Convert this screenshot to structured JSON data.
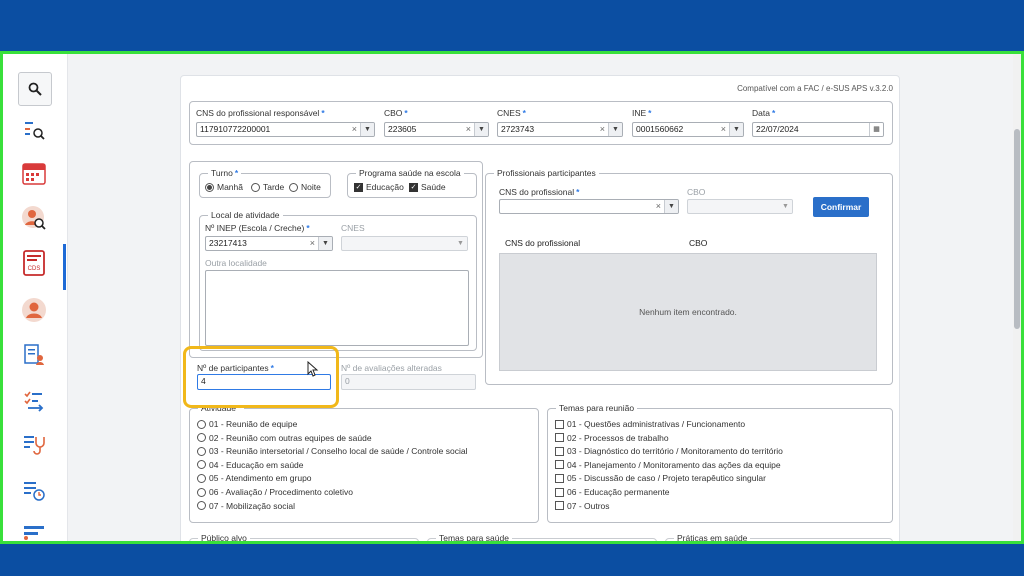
{
  "form": {
    "compat_text": "Compatível com a FAC / e-SUS APS v.3.2.0",
    "cns_responsavel": {
      "label": "CNS do profissional responsável",
      "value": "117910772200001"
    },
    "cbo": {
      "label": "CBO",
      "value": "223605"
    },
    "cnes": {
      "label": "CNES",
      "value": "2723743"
    },
    "ine": {
      "label": "INE",
      "value": "0001560662"
    },
    "data": {
      "label": "Data",
      "value": "22/07/2024"
    },
    "turno": {
      "legend": "Turno",
      "options": [
        "Manhã",
        "Tarde",
        "Noite"
      ],
      "selected": "Manhã"
    },
    "programa": {
      "legend": "Programa saúde na escola",
      "options": [
        "Educação",
        "Saúde"
      ]
    },
    "local": {
      "legend": "Local de atividade",
      "inep_label": "Nº INEP (Escola / Creche)",
      "inep_value": "23217413",
      "cnes_label": "CNES",
      "outra_label": "Outra localidade"
    },
    "participantes_label": "Nº de participantes",
    "participantes_value": "4",
    "avaliacoes_label": "Nº de avaliações alteradas",
    "avaliacoes_value": "0",
    "profissionais": {
      "legend": "Profissionais participantes",
      "cns_label": "CNS do profissional",
      "cbo_label": "CBO",
      "confirm_label": "Confirmar",
      "col_cns": "CNS do profissional",
      "col_cbo": "CBO",
      "empty_text": "Nenhum item encontrado."
    },
    "atividade": {
      "legend": "Atividade",
      "items": [
        "01 - Reunião de equipe",
        "02 - Reunião com outras equipes de saúde",
        "03 - Reunião intersetorial / Conselho local de saúde / Controle social",
        "04 - Educação em saúde",
        "05 - Atendimento em grupo",
        "06 - Avaliação / Procedimento coletivo",
        "07 - Mobilização social"
      ]
    },
    "temas_reuniao": {
      "legend": "Temas para reunião",
      "items": [
        "01 - Questões administrativas / Funcionamento",
        "02 - Processos de trabalho",
        "03 - Diagnóstico do território / Monitoramento do território",
        "04 - Planejamento / Monitoramento das ações da equipe",
        "05 - Discussão de caso / Projeto terapêutico singular",
        "06 - Educação permanente",
        "07 - Outros"
      ]
    },
    "bottom_legends": [
      "Público alvo",
      "Temas para saúde",
      "Práticas em saúde"
    ]
  },
  "sidebar": {
    "icons": [
      "search-icon",
      "people-search-icon",
      "calendar-icon",
      "user-search-icon",
      "document-cds-icon",
      "user-avatar-icon",
      "file-user-icon",
      "checklist-arrow-icon",
      "list-stethoscope-icon",
      "list-clock-icon",
      "list-icon"
    ]
  },
  "colors": {
    "accent": "#2a6fc9",
    "frame": "#39e03b",
    "highlight": "#f1b81a",
    "background": "#0b4ea2"
  }
}
